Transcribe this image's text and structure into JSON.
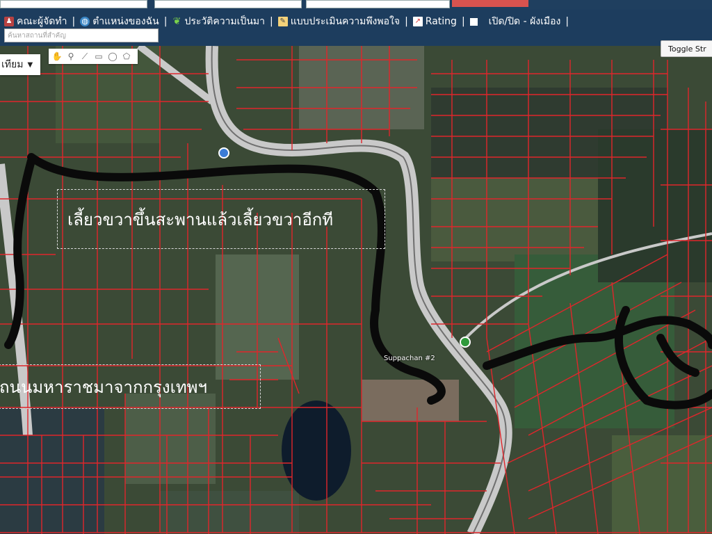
{
  "topstrip": {
    "field1": "",
    "field2": "",
    "field3": ""
  },
  "nav": {
    "items": [
      {
        "label": "คณะผู้จัดทำ",
        "icon": "team-icon"
      },
      {
        "label": "ตำแหน่งของฉัน",
        "icon": "globe-icon"
      },
      {
        "label": "ประวัติความเป็นมา",
        "icon": "sprout-icon"
      },
      {
        "label": "แบบประเมินความพึงพอใจ",
        "icon": "form-icon"
      },
      {
        "label": "Rating",
        "icon": "chart-icon"
      },
      {
        "label": "เปิด/ปิด - ผังเมือง",
        "icon": "square-icon"
      }
    ],
    "search_placeholder": "ค้นหาสถานที่สำคัญ"
  },
  "map": {
    "type_label": "เทียม",
    "toggle_button": "Toggle Str",
    "annotation_1": "เลี้ยวขวาขึ้นสะพานแล้วเลี้ยวขวาอีกที",
    "annotation_2": "ถนนมหาราชมาจากกรุงเทพฯ",
    "label_suppachan": "Suppachan #2"
  },
  "colors": {
    "nav_bg": "#1d3d5e",
    "parcel_line": "#e0262b",
    "road": "#c9c9c9",
    "marker": "#2e9a3a"
  }
}
